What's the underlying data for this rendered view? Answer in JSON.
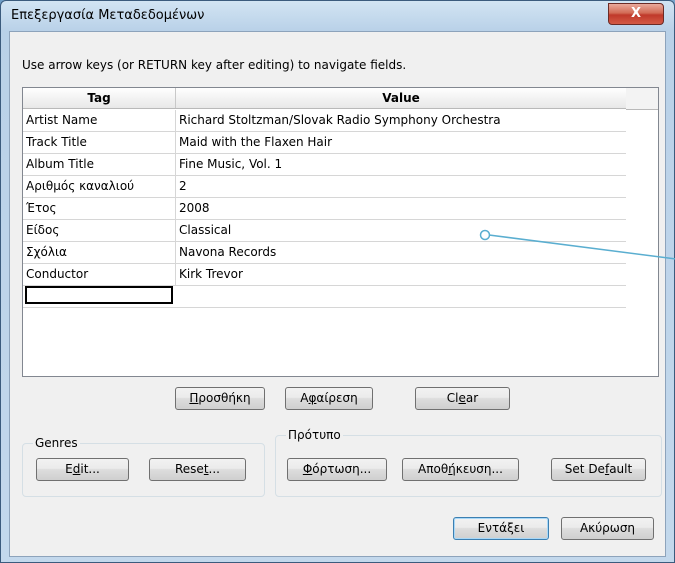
{
  "window": {
    "title": "Επεξεργασία Μεταδεδομένων",
    "close_label": "X"
  },
  "instruction": "Use arrow keys (or RETURN key after editing) to navigate fields.",
  "table": {
    "headers": {
      "tag": "Tag",
      "value": "Value"
    },
    "rows": [
      {
        "tag": "Artist Name",
        "value": "Richard Stoltzman/Slovak Radio Symphony Orchestra"
      },
      {
        "tag": "Track Title",
        "value": "Maid with the Flaxen Hair"
      },
      {
        "tag": "Album Title",
        "value": "Fine Music, Vol. 1"
      },
      {
        "tag": "Αριθμός καναλιού",
        "value": "2"
      },
      {
        "tag": "Έτος",
        "value": "2008"
      },
      {
        "tag": "Είδος",
        "value": "Classical"
      },
      {
        "tag": "Σχόλια",
        "value": "Navona Records"
      },
      {
        "tag": "Conductor",
        "value": "Kirk Trevor"
      }
    ]
  },
  "buttons": {
    "add": {
      "pre": "",
      "u": "Π",
      "post": "ροσθήκη"
    },
    "remove": {
      "pre": "Α",
      "u": "φ",
      "post": "αίρεση"
    },
    "clear": {
      "pre": "Cl",
      "u": "e",
      "post": "ar"
    }
  },
  "genres": {
    "label": "Genres",
    "edit": {
      "pre": "E",
      "u": "d",
      "post": "it..."
    },
    "reset": {
      "pre": "Rese",
      "u": "t",
      "post": "..."
    }
  },
  "template": {
    "label": "Πρότυπο",
    "load": {
      "pre": "",
      "u": "Φ",
      "post": "όρτωση..."
    },
    "save": {
      "pre": "Αποθ",
      "u": "ή",
      "post": "κευση..."
    },
    "set_default": {
      "pre": "Set De",
      "u": "f",
      "post": "ault"
    }
  },
  "footer": {
    "ok": "Εντάξει",
    "cancel": "Ακύρωση"
  },
  "colors": {
    "accent": "#3c7fb1",
    "close": "#c0392b",
    "annotation": "#5aaed0"
  }
}
